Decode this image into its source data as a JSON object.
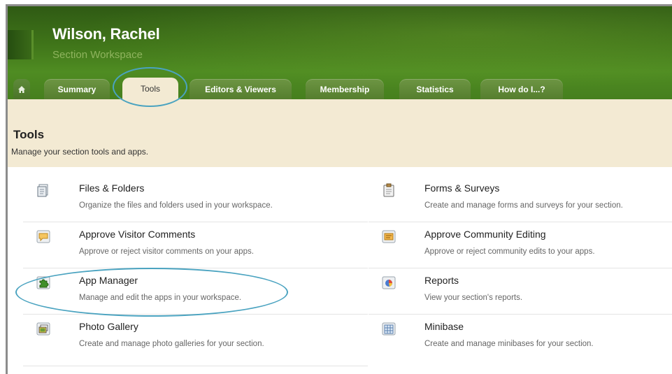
{
  "header": {
    "name": "Wilson, Rachel",
    "subtitle": "Section Workspace"
  },
  "tabs": [
    {
      "label": "Summary",
      "active": false
    },
    {
      "label": "Tools",
      "active": true
    },
    {
      "label": "Editors & Viewers",
      "active": false
    },
    {
      "label": "Membership",
      "active": false
    },
    {
      "label": "Statistics",
      "active": false
    },
    {
      "label": "How do I...?",
      "active": false
    }
  ],
  "section": {
    "title": "Tools",
    "description": "Manage your section tools and apps."
  },
  "tools": [
    {
      "title": "Files & Folders",
      "desc": "Organize the files and folders used in your workspace.",
      "icon": "files-icon"
    },
    {
      "title": "Forms & Surveys",
      "desc": "Create and manage forms and surveys for your section.",
      "icon": "forms-icon"
    },
    {
      "title": "Approve Visitor Comments",
      "desc": "Approve or reject visitor comments on your apps.",
      "icon": "comments-icon"
    },
    {
      "title": "Approve Community Editing",
      "desc": "Approve or reject community edits to your apps.",
      "icon": "community-edit-icon"
    },
    {
      "title": "App Manager",
      "desc": "Manage and edit the apps in your workspace.",
      "icon": "puzzle-icon"
    },
    {
      "title": "Reports",
      "desc": "View your section's reports.",
      "icon": "reports-icon"
    },
    {
      "title": "Photo Gallery",
      "desc": "Create and manage photo galleries for your section.",
      "icon": "gallery-icon"
    },
    {
      "title": "Minibase",
      "desc": "Create and manage minibases for your section.",
      "icon": "minibase-icon"
    }
  ],
  "colors": {
    "header_green": "#3f7419",
    "tab_green": "#6d9543",
    "section_bg": "#f3ead3",
    "highlight": "#4aa3c0"
  }
}
